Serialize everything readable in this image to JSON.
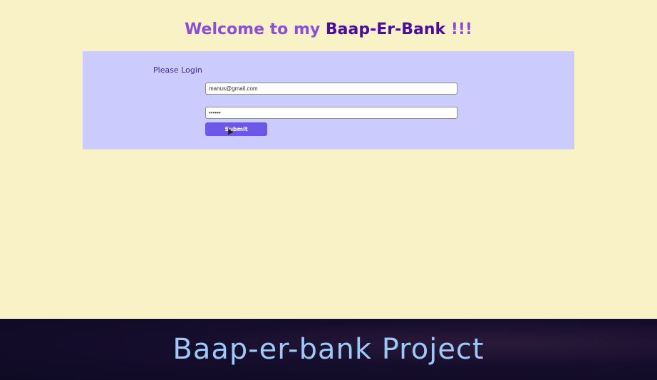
{
  "header": {
    "title_prefix": "Welcome to my ",
    "title_brand": "Baap-Er-Bank",
    "title_suffix": " !!!"
  },
  "login": {
    "heading": "Please Login",
    "email_value": "manus@gmail.com",
    "password_value": "••••••",
    "submit_label": "Submit"
  },
  "banner": {
    "text": "Baap-er-bank Project"
  },
  "colors": {
    "page_background": "#f9f2c7",
    "panel_background": "#cccbfd",
    "accent": "#6c57e6",
    "brand": "#4a0d9e",
    "banner_background": "#0e0a24",
    "banner_text": "#9cc9f7"
  }
}
